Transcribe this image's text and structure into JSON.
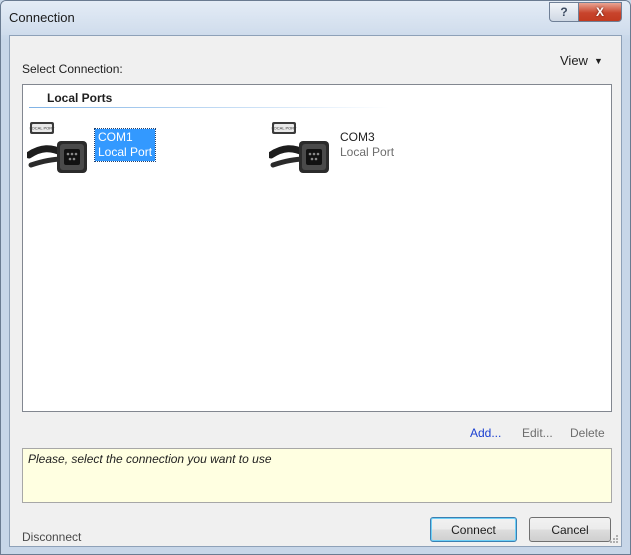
{
  "window": {
    "title": "Connection",
    "help_label": "?",
    "close_label": "X"
  },
  "toolbar": {
    "select_label": "Select Connection:",
    "view_label": "View"
  },
  "list": {
    "group_header": "Local Ports",
    "items": [
      {
        "name": "COM1",
        "type": "Local Port",
        "selected": true,
        "badge": "LOCAL PORT",
        "icon": "serial-port-icon"
      },
      {
        "name": "COM3",
        "type": "Local Port",
        "selected": false,
        "badge": "LOCAL PORT",
        "icon": "serial-port-icon"
      }
    ]
  },
  "actions": {
    "add": "Add...",
    "edit": "Edit...",
    "delete": "Delete"
  },
  "message": "Please, select the connection you want to use",
  "footer": {
    "disconnect": "Disconnect",
    "connect": "Connect",
    "cancel": "Cancel"
  },
  "colors": {
    "selection": "#3399ff",
    "message_bg": "#ffffe1",
    "link": "#1a3fd1",
    "close_button": "#c8442c"
  }
}
